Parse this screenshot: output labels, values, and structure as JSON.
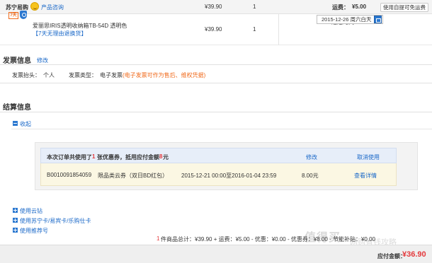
{
  "header": {
    "store_name": "苏宁易购",
    "consult_label": "产品咨询",
    "price": "¥39.90",
    "quantity": "1",
    "shipping_label": "运费：",
    "shipping_value": "¥5.00",
    "self_pickup_button": "使用自提可免运费"
  },
  "item": {
    "badge": "7天",
    "name": "爱丽思IRIS透明收纳箱TB-54D 透明色",
    "return_policy": "【7天无理由退换货】",
    "price": "¥39.90",
    "quantity": "1",
    "delivery_label": "送达时间",
    "delivery_date": "2015-12-26 周六白天"
  },
  "invoice": {
    "title": "发票信息",
    "edit_link": "修改",
    "header_label": "发票抬头：",
    "header_value": "个人",
    "type_label": "发票类型：",
    "type_value": "电子发票",
    "type_note": "(电子发票可作为售后、维权凭据)"
  },
  "settlement": {
    "title": "结算信息",
    "collapse_label": "收起",
    "coupon_summary_prefix": "本次订单共使用了",
    "coupon_count": "1",
    "coupon_summary_mid": "张优惠券，抵用应付金额",
    "coupon_amount": "8",
    "coupon_summary_suffix": "元",
    "modify_link": "修改",
    "cancel_link": "取消使用",
    "coupon": {
      "code": "B0010091854059",
      "name": "限品类云券（双日BD红包）",
      "validity": "2015-12-21 00:00至2016-01-04 23:59",
      "amount": "8.00元",
      "detail_link": "查看详情"
    },
    "options": [
      "使用云钻",
      "使用苏宁卡/易宾卡/乐购仕卡",
      "使用推荐号"
    ]
  },
  "summary": {
    "count": "1",
    "line": "件商品总计：¥39.90 + 运费：¥5.00 - 优惠：¥0.00 - 优惠券：¥8.00 - 节能补贴：¥0.00"
  },
  "footer": {
    "payable_label": "应付金额：",
    "payable_value": "¥36.90"
  },
  "watermark": {
    "main": "值得买",
    "sub": "网购省钱攻略"
  },
  "colors": {
    "link_blue": "#1a68c8",
    "accent_orange": "#f06a1b",
    "price_red": "#e4393c"
  }
}
